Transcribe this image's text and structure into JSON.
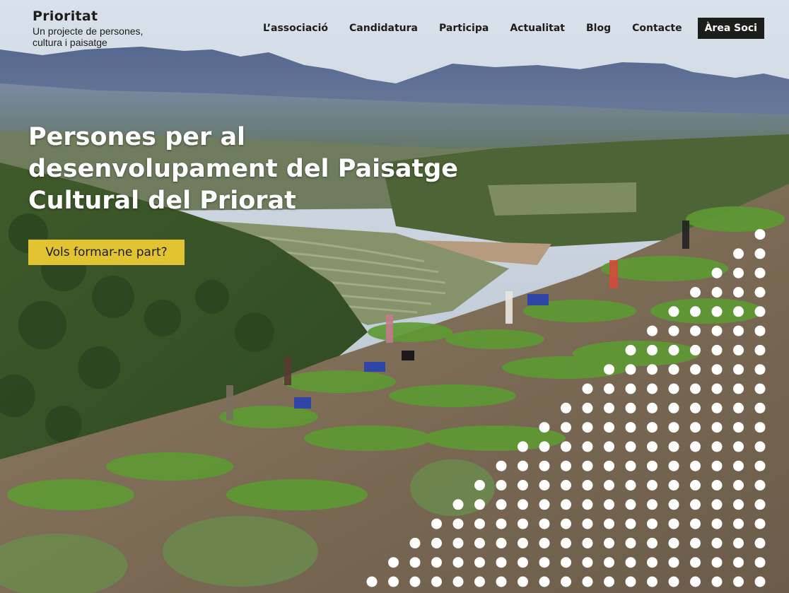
{
  "site": {
    "brand_name": "Prioritat",
    "brand_tagline_line1": "Un projecte de persones,",
    "brand_tagline_line2": "cultura i paisatge"
  },
  "nav": {
    "items": [
      {
        "label": "L’associació"
      },
      {
        "label": "Candidatura"
      },
      {
        "label": "Participa"
      },
      {
        "label": "Actualitat"
      },
      {
        "label": "Blog"
      },
      {
        "label": "Contacte"
      }
    ],
    "member_area_label": "Àrea Soci"
  },
  "hero": {
    "headline_line1": "Persones per al",
    "headline_line2": "desenvolupament del Paisatge",
    "headline_line3": "Cultural del Priorat",
    "cta_label": "Vols formar-ne part?"
  },
  "colors": {
    "accent_yellow": "#e2c332",
    "dark": "#1d1d1b",
    "dots": "#ffffff"
  }
}
